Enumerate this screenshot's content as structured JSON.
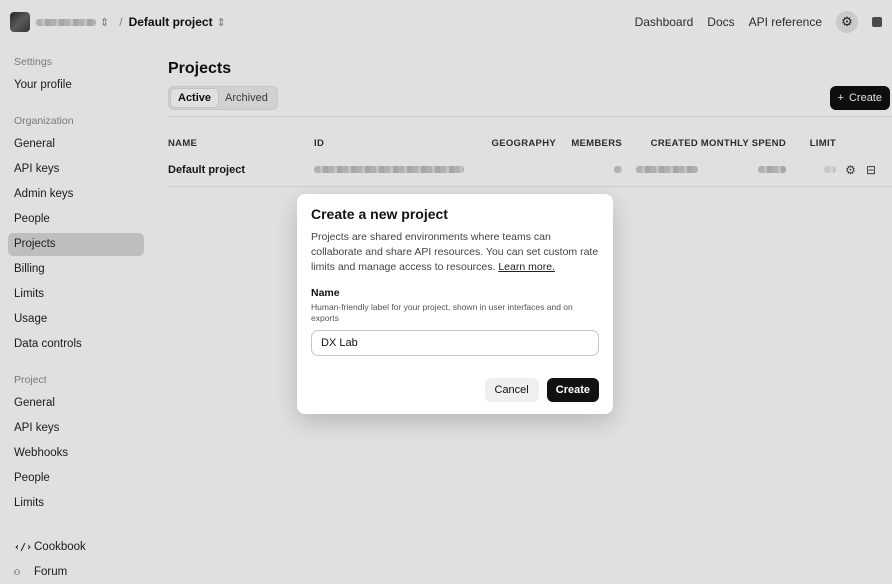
{
  "topbar": {
    "project_name": "Default project",
    "breadcrumb_separator": "/",
    "links": [
      "Dashboard",
      "Docs",
      "API reference"
    ]
  },
  "sidebar": {
    "settings_heading": "Settings",
    "profile": "Your profile",
    "org_heading": "Organization",
    "org_items": [
      "General",
      "API keys",
      "Admin keys",
      "People",
      "Projects",
      "Billing",
      "Limits",
      "Usage",
      "Data controls"
    ],
    "project_heading": "Project",
    "project_items": [
      "General",
      "API keys",
      "Webhooks",
      "People",
      "Limits"
    ],
    "bottom_items": [
      "Cookbook",
      "Forum"
    ]
  },
  "main": {
    "title": "Projects",
    "tabs": [
      "Active",
      "Archived"
    ],
    "create_label": "Create",
    "columns": [
      "NAME",
      "ID",
      "GEOGRAPHY",
      "MEMBERS",
      "CREATED",
      "MONTHLY SPEND",
      "LIMIT"
    ],
    "rows": [
      {
        "name": "Default project"
      }
    ]
  },
  "modal": {
    "title": "Create a new project",
    "description": "Projects are shared environments where teams can collaborate and share API resources. You can set custom rate limits and manage access to resources.",
    "learn_more": "Learn more.",
    "field_label": "Name",
    "field_help": "Human-friendly label for your project, shown in user interfaces and on exports",
    "field_value": "DX Lab",
    "cancel_label": "Cancel",
    "create_label": "Create"
  }
}
